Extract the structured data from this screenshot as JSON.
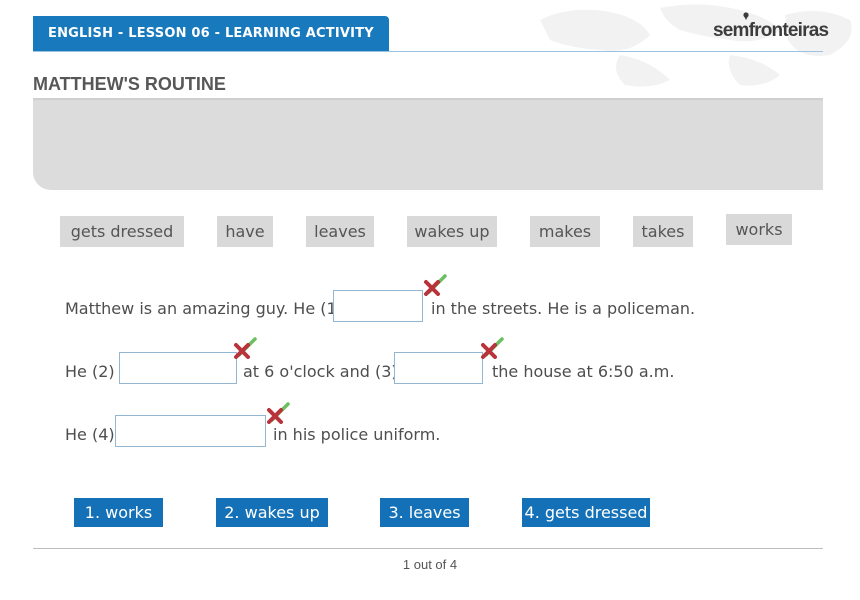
{
  "header": {
    "lesson_title": "ENGLISH - LESSON 06 - LEARNING ACTIVITY",
    "brand": "semfronteiras",
    "accent_color": "#1879bd"
  },
  "activity": {
    "title": "MATTHEW'S ROUTINE"
  },
  "word_bank": [
    "gets dressed",
    "have",
    "leaves",
    "wakes up",
    "makes",
    "takes",
    "works"
  ],
  "sentences": {
    "s1_a": "Matthew is an amazing guy. He (1)",
    "s1_b": "in the streets. He is a policeman.",
    "s2_a": "He (2)",
    "s2_b": "at 6 o'clock and (3)",
    "s2_c": "the house at 6:50 a.m.",
    "s3_a": "He (4)",
    "s3_b": "in his police uniform."
  },
  "answers": [
    "1. works",
    "2. wakes up",
    "3. leaves",
    "4. gets dressed"
  ],
  "pager": "1 out of 4",
  "icons": {
    "check": "check-icon",
    "cross": "cross-icon"
  },
  "colors": {
    "check": "#6cbf62",
    "cross": "#b8343a",
    "answer_bg": "#1571b7"
  }
}
